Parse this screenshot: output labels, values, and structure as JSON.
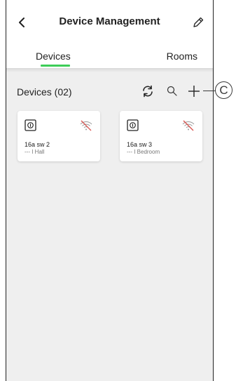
{
  "header": {
    "title": "Device Management",
    "back_icon": "chevron-left-icon",
    "edit_icon": "pencil-icon"
  },
  "tabs": [
    {
      "label": "Devices",
      "active": true
    },
    {
      "label": "Rooms",
      "active": false
    }
  ],
  "toolbar": {
    "devices_count_label": "Devices (02)",
    "refresh_icon": "refresh-icon",
    "search_icon": "search-icon",
    "add_icon": "plus-icon"
  },
  "devices": [
    {
      "name": "16a sw 2",
      "room": "--- I Hall",
      "status_icon": "wifi-off-icon"
    },
    {
      "name": "16a sw 3",
      "room": "--- I Bedroom",
      "status_icon": "wifi-off-icon"
    }
  ],
  "callout": {
    "label": "C"
  },
  "colors": {
    "accent": "#3dcd58",
    "offline": "#d9534f",
    "background": "#efefef"
  }
}
